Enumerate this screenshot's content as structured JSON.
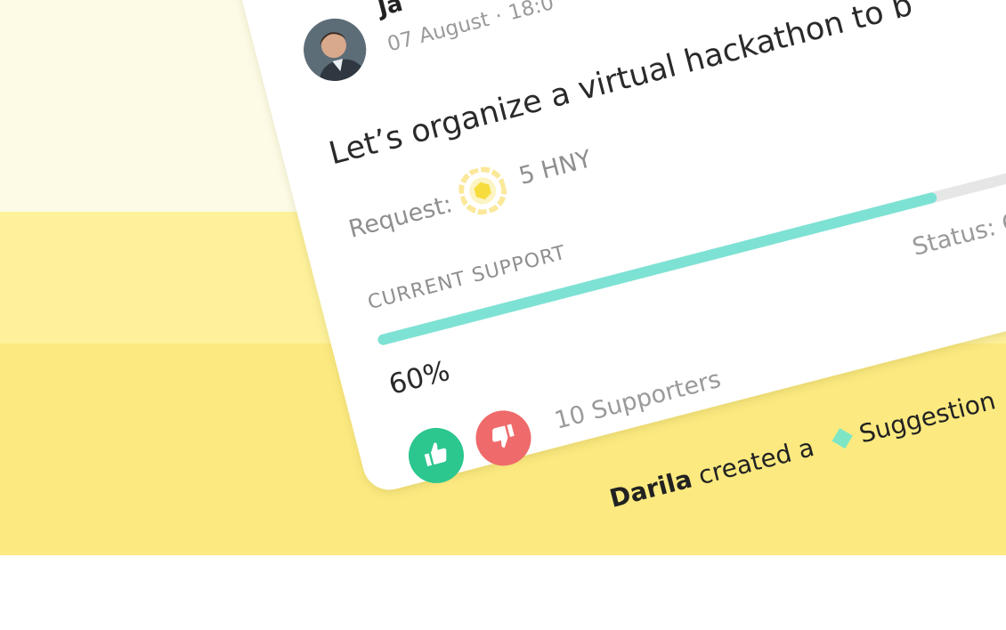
{
  "post": {
    "author": "Ja",
    "date": "07 August",
    "time": "18:0",
    "title": "Let’s organize a virtual hackathon to b",
    "request_label": "Request:",
    "request_amount": "5 HNY",
    "support_label": "CURRENT SUPPORT",
    "support_percent": "60%",
    "support_fraction": 0.6,
    "status": "Status: Open",
    "supporters": "10 Supporters"
  },
  "activity": {
    "name": "Darila",
    "text": "created a",
    "type": "Suggestion"
  },
  "colors": {
    "progress": "#7de2d4",
    "upvote": "#2cc68f",
    "downvote": "#ef6a6a",
    "background_yellow": "#fcea80",
    "suggestion_diamond": "#7ee6c5"
  },
  "icons": {
    "upvote": "thumbs-up-icon",
    "downvote": "thumbs-down-icon",
    "token": "honey-token-icon"
  }
}
